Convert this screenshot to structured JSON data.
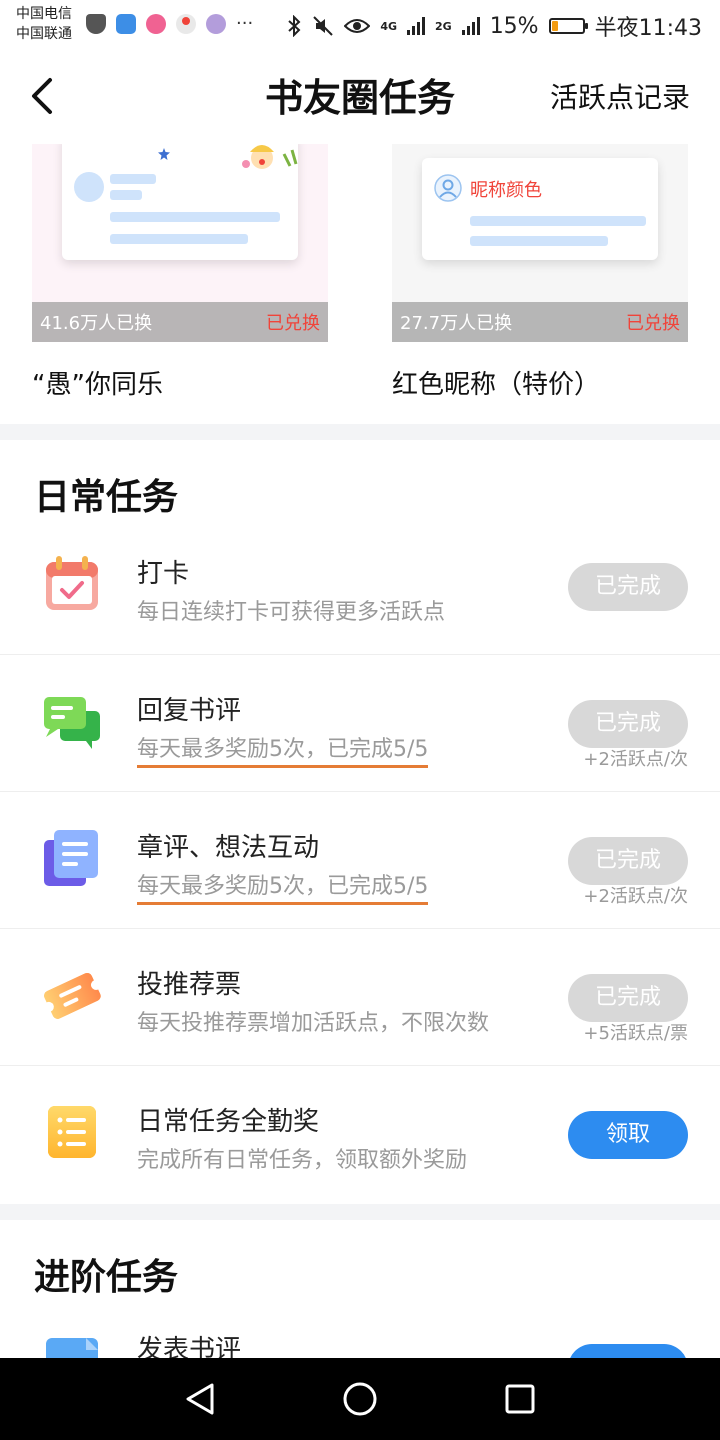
{
  "status_bar": {
    "carrier1": "中国电信",
    "carrier2": "中国联通",
    "network1": "4G",
    "network2": "2G",
    "battery": "15%",
    "time": "半夜11:43"
  },
  "header": {
    "title": "书友圈任务",
    "right_link": "活跃点记录"
  },
  "rewards": [
    {
      "count": "41.6万人已换",
      "state": "已兑换",
      "name": "“愚”你同乐"
    },
    {
      "count": "27.7万人已换",
      "state": "已兑换",
      "name": "红色昵称（特价）",
      "preview_text": "昵称颜色"
    }
  ],
  "daily": {
    "title": "日常任务",
    "tasks": [
      {
        "title": "打卡",
        "desc": "每日连续打卡可获得更多活跃点",
        "button": "已完成",
        "status": "done",
        "icon": "calendar-check-icon"
      },
      {
        "title": "回复书评",
        "desc": "每天最多奖励5次，已完成5/5",
        "button": "已完成",
        "note": "+2活跃点/次",
        "status": "done",
        "icon": "chat-bubbles-icon"
      },
      {
        "title": "章评、想法互动",
        "desc": "每天最多奖励5次，已完成5/5",
        "button": "已完成",
        "note": "+2活跃点/次",
        "status": "done",
        "icon": "document-stack-icon"
      },
      {
        "title": "投推荐票",
        "desc": "每天投推荐票增加活跃点，不限次数",
        "button": "已完成",
        "note": "+5活跃点/票",
        "status": "done",
        "icon": "ticket-icon"
      },
      {
        "title": "日常任务全勤奖",
        "desc": "完成所有日常任务，领取额外奖励",
        "button": "领取",
        "status": "claimable",
        "icon": "list-icon"
      }
    ]
  },
  "advanced": {
    "title": "进阶任务",
    "first_task_title": "发表书评"
  },
  "colors": {
    "accent_blue": "#2d8cf0",
    "done_gray": "#d8d8d8",
    "red": "#f0443a",
    "underline_orange": "#e57c35"
  }
}
